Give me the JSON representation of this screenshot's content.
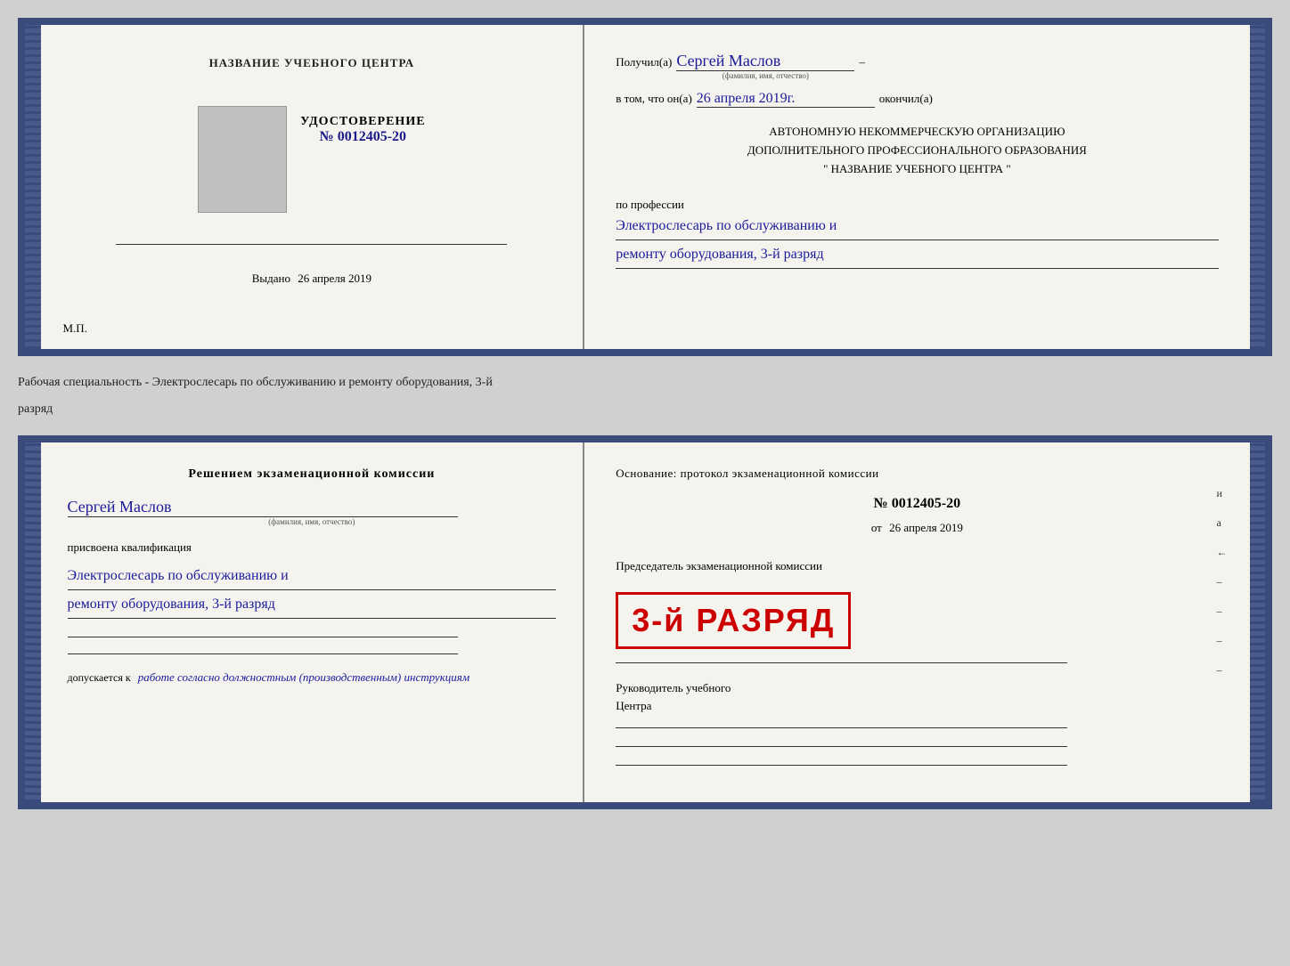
{
  "top_cert": {
    "left": {
      "center_title": "НАЗВАНИЕ УЧЕБНОГО ЦЕНТРА",
      "photo_label": "",
      "udostoverenie_title": "УДОСТОВЕРЕНИЕ",
      "udostoverenie_num": "№ 0012405-20",
      "vydano_label": "Выдано",
      "vydano_date": "26 апреля 2019",
      "mp": "М.П."
    },
    "right": {
      "poluchil": "Получил(а)",
      "name": "Сергей Маслов",
      "name_sublabel": "(фамилия, имя, отчество)",
      "dash": "–",
      "vtom_label": "в том, что он(а)",
      "vtom_date": "26 апреля 2019г.",
      "okonchil": "окончил(а)",
      "main_line1": "АВТОНОМНУЮ НЕКОММЕРЧЕСКУЮ ОРГАНИЗАЦИЮ",
      "main_line2": "ДОПОЛНИТЕЛЬНОГО ПРОФЕССИОНАЛЬНОГО ОБРАЗОВАНИЯ",
      "main_line3": "\"   НАЗВАНИЕ УЧЕБНОГО ЦЕНТРА   \"",
      "po_professii": "по профессии",
      "profession_line1": "Электрослесарь по обслуживанию и",
      "profession_line2": "ремонту оборудования, 3-й разряд"
    }
  },
  "between": {
    "text": "Рабочая специальность - Электрослесарь по обслуживанию и ремонту оборудования, 3-й",
    "text2": "разряд"
  },
  "bottom_cert": {
    "left": {
      "resheniem": "Решением экзаменационной комиссии",
      "name": "Сергей Маслов",
      "name_sublabel": "(фамилия, имя, отчество)",
      "prisvoena": "присвоена квалификация",
      "qual_line1": "Электрослесарь по обслуживанию и",
      "qual_line2": "ремонту оборудования, 3-й разряд",
      "dopuskaetsya": "допускается к",
      "dopusk_text": "работе согласно должностным (производственным) инструкциям"
    },
    "right": {
      "osnovanie": "Основание: протокол экзаменационной комиссии",
      "num": "№  0012405-20",
      "ot_label": "от",
      "ot_date": "26 апреля 2019",
      "predsedatel": "Председатель экзаменационной комиссии",
      "stamp_line1": "3-й разряд",
      "stamp_big": "3-й РАЗРЯД",
      "rukovoditel": "Руководитель учебного",
      "tsentra": "Центра"
    },
    "right_marks": [
      "и",
      "а",
      "←",
      "–",
      "–",
      "–",
      "–"
    ]
  }
}
